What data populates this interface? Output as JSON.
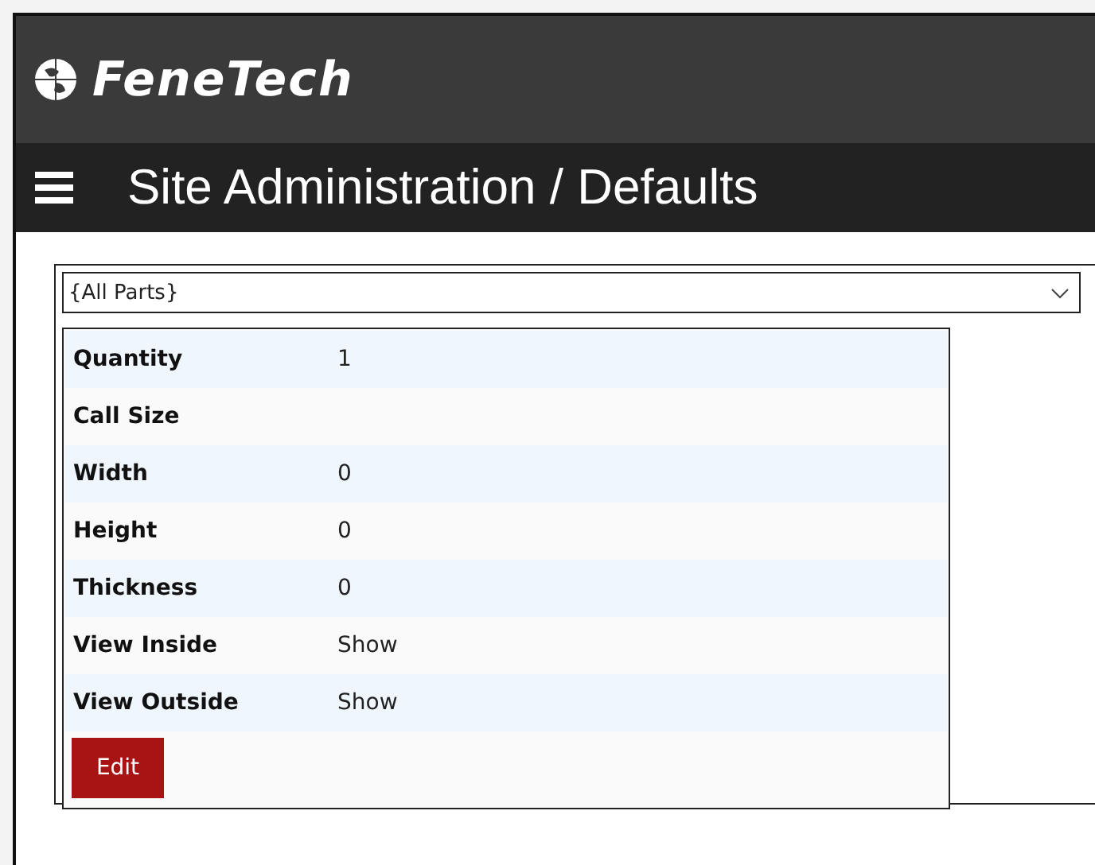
{
  "logo": {
    "text": "FeneTech"
  },
  "title": "Site Administration / Defaults",
  "part_select": {
    "value": "{All Parts}"
  },
  "fields": [
    {
      "label": "Quantity",
      "value": "1"
    },
    {
      "label": "Call Size"
    },
    {
      "label": "Width",
      "value": "0"
    },
    {
      "label": "Height",
      "value": "0"
    },
    {
      "label": "Thickness",
      "value": "0"
    },
    {
      "label": "View Inside",
      "value": "Show"
    },
    {
      "label": "View Outside",
      "value": "Show"
    }
  ],
  "buttons": [
    "Edit"
  ]
}
